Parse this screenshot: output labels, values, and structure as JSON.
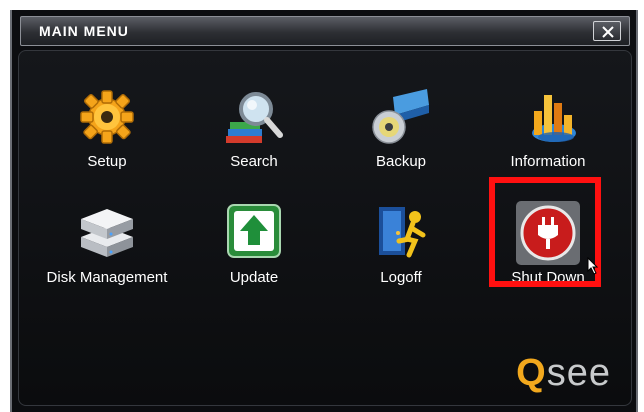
{
  "window": {
    "title": "MAIN MENU"
  },
  "menu": {
    "items": [
      {
        "label": "Setup",
        "icon": "gear-icon"
      },
      {
        "label": "Search",
        "icon": "magnifier-books-icon"
      },
      {
        "label": "Backup",
        "icon": "disc-drive-icon"
      },
      {
        "label": "Information",
        "icon": "bar-chart-icon"
      },
      {
        "label": "Disk Management",
        "icon": "hard-disk-icon"
      },
      {
        "label": "Update",
        "icon": "upload-arrow-icon"
      },
      {
        "label": "Logoff",
        "icon": "door-exit-icon"
      },
      {
        "label": "Shut Down",
        "icon": "power-plug-icon"
      }
    ]
  },
  "logo": {
    "q": "Q",
    "rest": "see"
  },
  "colors": {
    "highlight": "#ff1010",
    "logo_q": "#f2a81d",
    "shutdown": "#c81c1c"
  }
}
